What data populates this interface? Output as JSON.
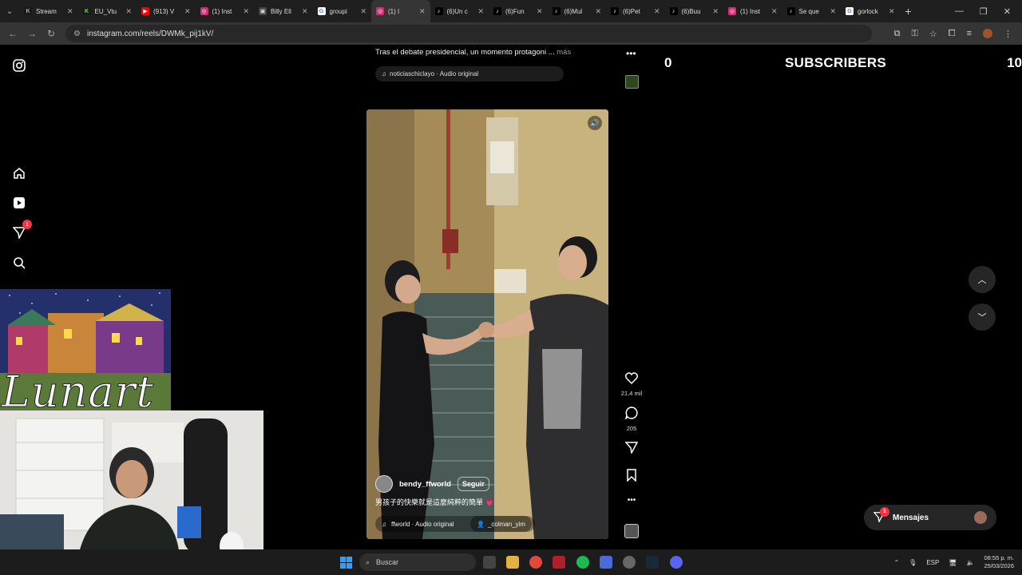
{
  "browser": {
    "tabs": [
      {
        "label": "Stream",
        "fav_color": "#1a1a1a",
        "fav_text": "K",
        "fav_fg": "#53fc18"
      },
      {
        "label": "EU_Vtu",
        "fav_color": "#1a1a1a",
        "fav_text": "K",
        "fav_fg": "#53fc18"
      },
      {
        "label": "(913) V",
        "fav_color": "#ff0000",
        "fav_text": "▶",
        "fav_fg": "#fff"
      },
      {
        "label": "(1) Inst",
        "fav_color": "#d62976",
        "fav_text": "◎",
        "fav_fg": "#fff"
      },
      {
        "label": "Billy Ell",
        "fav_color": "#444",
        "fav_text": "▣",
        "fav_fg": "#ddd"
      },
      {
        "label": "groupi",
        "fav_color": "#fff",
        "fav_text": "G",
        "fav_fg": "#4285f4"
      },
      {
        "label": "(1) I",
        "fav_color": "#d62976",
        "fav_text": "◎",
        "fav_fg": "#fff",
        "active": true
      },
      {
        "label": "(6)Un c",
        "fav_color": "#000",
        "fav_text": "♪",
        "fav_fg": "#fff"
      },
      {
        "label": "(6)Fun",
        "fav_color": "#000",
        "fav_text": "♪",
        "fav_fg": "#fff"
      },
      {
        "label": "(6)Mul",
        "fav_color": "#000",
        "fav_text": "♪",
        "fav_fg": "#fff"
      },
      {
        "label": "(6)Pet",
        "fav_color": "#000",
        "fav_text": "♪",
        "fav_fg": "#fff"
      },
      {
        "label": "(6)Buu",
        "fav_color": "#000",
        "fav_text": "♪",
        "fav_fg": "#fff"
      },
      {
        "label": "(1) Inst",
        "fav_color": "#d62976",
        "fav_text": "◎",
        "fav_fg": "#fff"
      },
      {
        "label": "Se que",
        "fav_color": "#000",
        "fav_text": "♪",
        "fav_fg": "#fff"
      },
      {
        "label": "gorlock",
        "fav_color": "#fff",
        "fav_text": "G",
        "fav_fg": "#4285f4"
      }
    ],
    "url": "instagram.com/reels/DWMk_pij1kV/"
  },
  "prev_reel": {
    "caption": "Tras el debate presidencial, un momento protagoni ...",
    "more": "más",
    "audio": "noticiaschiclayo · Audio original"
  },
  "reel": {
    "username": "bendy_ffworld",
    "follow_label": "Seguir",
    "caption": "男孩子的快樂就是這麼純粹的簡單 💗",
    "audio": "ffworld · Audio original",
    "tagged_user": "_colman_yim",
    "likes": "21,4 mil",
    "comments": "205"
  },
  "overlay": {
    "subs_left": "0",
    "subs_label": "SUBSCRIBERS",
    "subs_right": "10",
    "art_title": "Lunart"
  },
  "messages": {
    "label": "Mensajes",
    "badge": "1"
  },
  "nav": {
    "notif_badge": "1"
  },
  "taskbar": {
    "search_placeholder": "Buscar",
    "lang": "ESP",
    "time": "08:55 p. m.",
    "date": "25/03/2026"
  }
}
